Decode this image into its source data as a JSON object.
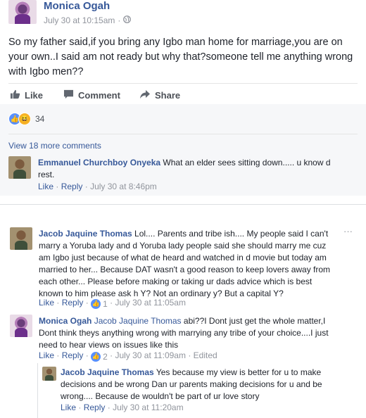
{
  "post": {
    "author": "Monica Ogah",
    "timestamp": "July 30 at 10:15am",
    "visibility_icon": "globe-icon",
    "text": "So my father said,if you bring any Igbo man home for marriage,you are on your own..I said am not ready but why that?someone tell me anything wrong with Igbo men??",
    "actions": {
      "like": "Like",
      "comment": "Comment",
      "share": "Share"
    },
    "reaction_count": "34",
    "reactions": [
      "like",
      "haha"
    ],
    "colors": {
      "link": "#365899",
      "meta": "#90949c",
      "like_blue": "#5890ff",
      "haha_yellow": "#f7b125"
    }
  },
  "comments": {
    "more_link": "View 18 more comments",
    "items": [
      {
        "author": "Emmanuel Churchboy Onyeka",
        "text": "What an elder sees sitting down..... u know d rest.",
        "like": "Like",
        "reply": "Reply",
        "time": "July 30 at 8:46pm"
      }
    ]
  },
  "thread": {
    "items": [
      {
        "author": "Jacob Jaquine Thomas",
        "text": "Lol.... Parents and tribe ish.... My people said I can't marry a Yoruba lady and d Yoruba lady people said she should marry me cuz am Igbo just because of what de heard and watched in d movie but today am married to her... Because DAT wasn't a good reason to keep lovers away from each other... Please before making or taking ur dads advice which is best known to him please ask h Y? Not an ordinary y? But a capital Y?",
        "like": "Like",
        "reply": "Reply",
        "likes": "1",
        "time": "July 30 at 11:05am",
        "menu": "···"
      },
      {
        "author": "Monica Ogah",
        "mention": "Jacob Jaquine Thomas",
        "text": "abi??I Dont just get the whole matter,I Dont think theys anything wrong with marrying any tribe of your choice....I just need to hear views on issues like this",
        "like": "Like",
        "reply": "Reply",
        "likes": "2",
        "time": "July 30 at 11:09am",
        "edited": "Edited"
      },
      {
        "author": "Jacob Jaquine Thomas",
        "text": "Yes because my view is better for u to make decisions and be wrong Dan ur parents making decisions for u and be wrong.... Because de wouldn't be part of ur love story",
        "like": "Like",
        "reply": "Reply",
        "time": "July 30 at 11:20am"
      }
    ]
  }
}
